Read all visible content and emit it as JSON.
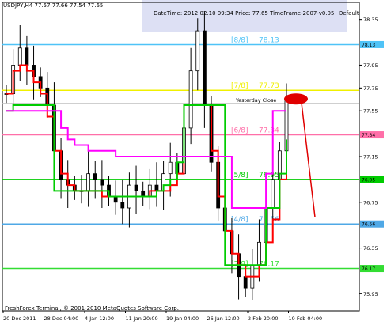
{
  "header": {
    "symbol_line": "USDJPY,H4  77.57 77.66 77.54 77.65",
    "info_line": "DateTime: 2012.02.10 09:34   Price: 77.65   TimeFrame-2007-v0.05",
    "default_label": "Default"
  },
  "footer": {
    "copyright": "FreshForex Terminal, © 2001-2010 MetaQuotes Software Corp."
  },
  "colors": {
    "background": "#ffffff",
    "info_panel": "#dde0f4",
    "candles": "#000000",
    "red_line": "#ff0000",
    "green_line": "#00cc00",
    "magenta_line": "#ff00ff",
    "level_8_8": "#4fc3f7",
    "level_7_8": "#f0f000",
    "level_6_8": "#ff6fa8",
    "level_5_8": "#00cc00",
    "level_4_8": "#4fa8e6",
    "level_3_8": "#33dd33",
    "forecast_arrow": "#e00000",
    "yesterday_close_line": "#bfbfbf"
  },
  "chart_data": {
    "type": "candlestick",
    "symbol": "USDJPY",
    "timeframe": "H4",
    "ohlc": {
      "open": 77.57,
      "high": 77.66,
      "low": 77.54,
      "close": 77.65
    },
    "ylim": [
      75.8,
      78.5
    ],
    "y_ticks": [
      "78.35",
      "78.13",
      "77.95",
      "77.75",
      "77.55",
      "77.34",
      "77.15",
      "76.95",
      "76.75",
      "76.56",
      "76.35",
      "76.17",
      "75.95"
    ],
    "x_ticks": [
      "20 Dec 2011",
      "28 Dec 04:00",
      "4 Jan 12:00",
      "11 Jan 20:00",
      "19 Jan 04:00",
      "26 Jan 12:00",
      "2 Feb 20:00",
      "10 Feb 04:00"
    ],
    "murrey_levels": [
      {
        "label": "[8/8]",
        "value": "78.13",
        "color_key": "level_8_8"
      },
      {
        "label": "[7/8]",
        "value": "77.73",
        "color_key": "level_7_8"
      },
      {
        "label": "[6/8]",
        "value": "77.34",
        "color_key": "level_6_8"
      },
      {
        "label": "[5/8]",
        "value": "76.95",
        "color_key": "level_5_8"
      },
      {
        "label": "[4/8]",
        "value": "76.56",
        "color_key": "level_4_8"
      },
      {
        "label": "[3/8]",
        "value": "76.17",
        "color_key": "level_3_8"
      }
    ],
    "yesterday_close_label": "Yesterday Close",
    "current_price": "77.65",
    "highlighted_price": "77.73",
    "grid": false,
    "series": [
      {
        "name": "close",
        "color_key": "candles",
        "values": [
          77.7,
          77.95,
          78.1,
          77.95,
          77.85,
          77.75,
          77.6,
          77.2,
          76.95,
          76.9,
          76.85,
          76.85,
          77.0,
          76.95,
          76.9,
          76.8,
          76.75,
          76.7,
          76.9,
          76.85,
          76.8,
          76.9,
          76.85,
          77.0,
          77.1,
          77.0,
          77.4,
          77.9,
          78.25,
          77.6,
          77.1,
          76.7,
          76.5,
          76.3,
          76.1,
          76.0,
          76.2,
          76.4,
          76.7,
          76.95,
          77.2,
          77.65
        ]
      },
      {
        "name": "red",
        "color_key": "red_line",
        "values": [
          77.7,
          77.9,
          77.95,
          77.9,
          77.8,
          77.7,
          77.5,
          77.2,
          77.0,
          76.9,
          76.85,
          76.85,
          76.85,
          76.85,
          76.8,
          76.8,
          76.8,
          76.8,
          76.8,
          76.8,
          76.8,
          76.85,
          76.85,
          76.85,
          76.9,
          77.0,
          77.6,
          77.6,
          77.6,
          77.6,
          77.2,
          76.8,
          76.5,
          76.3,
          76.2,
          76.1,
          76.1,
          76.2,
          76.4,
          76.6,
          76.95,
          77.15
        ]
      },
      {
        "name": "green",
        "color_key": "green_line",
        "values": [
          77.55,
          77.6,
          77.6,
          77.6,
          77.6,
          77.6,
          77.6,
          76.85,
          76.85,
          76.85,
          76.85,
          76.85,
          76.85,
          76.85,
          76.85,
          76.8,
          76.8,
          76.8,
          76.8,
          76.8,
          76.8,
          76.8,
          76.85,
          76.9,
          76.95,
          77.1,
          77.6,
          77.6,
          77.6,
          77.6,
          77.6,
          77.6,
          76.2,
          76.2,
          76.2,
          76.2,
          76.2,
          76.2,
          76.7,
          76.7,
          77.0,
          77.3
        ]
      },
      {
        "name": "magenta",
        "color_key": "magenta_line",
        "values": [
          77.55,
          77.55,
          77.55,
          77.55,
          77.55,
          77.55,
          77.55,
          77.55,
          77.4,
          77.3,
          77.25,
          77.25,
          77.2,
          77.2,
          77.2,
          77.2,
          77.15,
          77.15,
          77.15,
          77.15,
          77.15,
          77.15,
          77.15,
          77.15,
          77.15,
          77.15,
          77.15,
          77.15,
          77.15,
          77.15,
          77.15,
          77.15,
          77.15,
          76.7,
          76.7,
          76.7,
          76.7,
          76.7,
          77.0,
          77.55,
          77.55,
          77.55
        ]
      }
    ],
    "forecast": [
      {
        "from": 77.65,
        "to": 76.62
      }
    ]
  }
}
